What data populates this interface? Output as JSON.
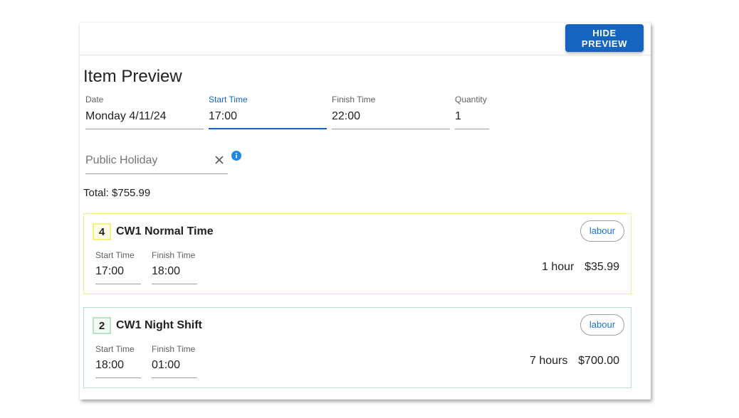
{
  "toolbar": {
    "hide_preview_label": "HIDE PREVIEW"
  },
  "preview": {
    "title": "Item Preview",
    "fields": {
      "date": {
        "label": "Date",
        "value": "Monday 4/11/24"
      },
      "start_time": {
        "label": "Start Time",
        "value": "17:00"
      },
      "finish_time": {
        "label": "Finish Time",
        "value": "22:00"
      },
      "quantity": {
        "label": "Quantity",
        "value": "1"
      }
    },
    "public_holiday": {
      "placeholder": "Public Holiday",
      "clear_icon": "close-icon",
      "info_icon": "info-icon"
    },
    "total": "Total: $755.99"
  },
  "items": [
    {
      "quantity": "4",
      "name": "CW1 Normal Time",
      "tag": "labour",
      "start_label": "Start Time",
      "start": "17:00",
      "finish_label": "Finish Time",
      "finish": "18:00",
      "duration": "1 hour",
      "amount": "$35.99",
      "accent": "#f1ee8e"
    },
    {
      "quantity": "2",
      "name": "CW1 Night Shift",
      "tag": "labour",
      "start_label": "Start Time",
      "start": "18:00",
      "finish_label": "Finish Time",
      "finish": "01:00",
      "duration": "7 hours",
      "amount": "$700.00",
      "accent": "#b8e0cc"
    }
  ],
  "colors": {
    "primary": "#1565c0",
    "info": "#1e88e5"
  }
}
